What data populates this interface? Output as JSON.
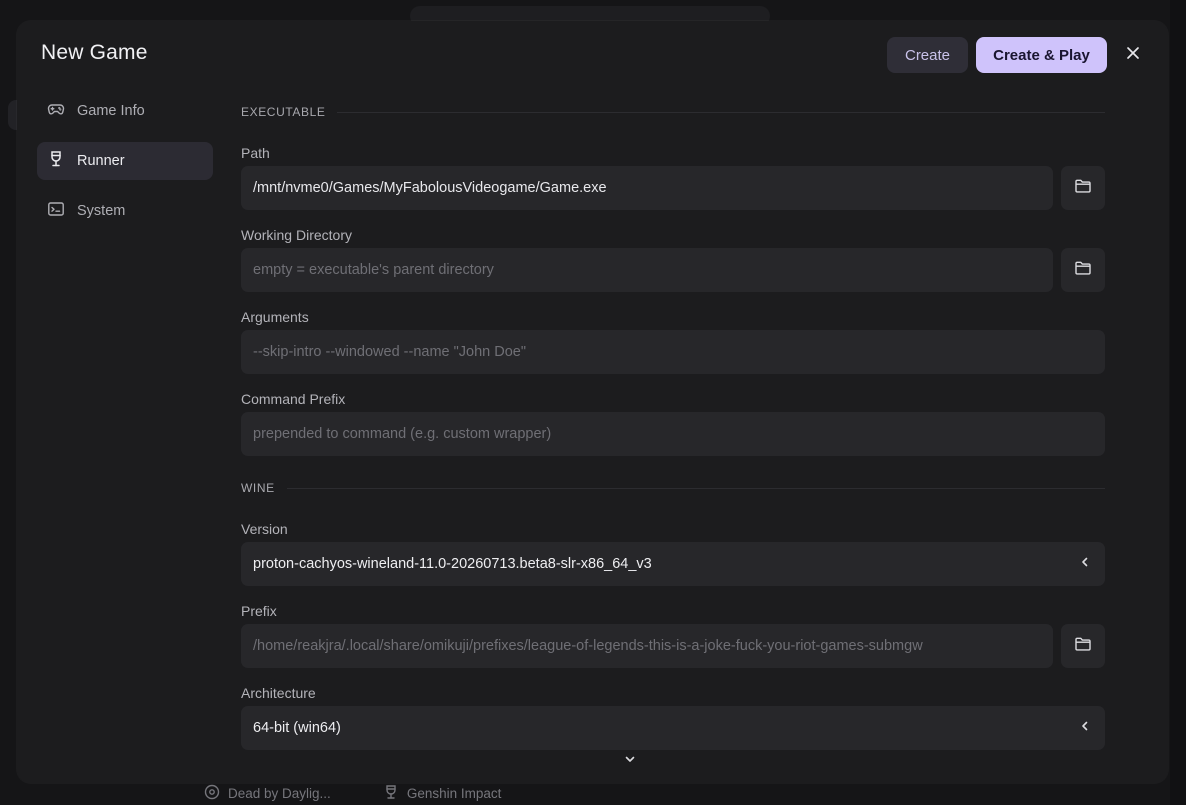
{
  "background": {
    "footer_items": [
      {
        "label": "Dead by Daylig...",
        "icon": "disc-icon"
      },
      {
        "label": "Genshin Impact",
        "icon": "goblet-icon"
      }
    ]
  },
  "dialog": {
    "title": "New Game",
    "create_label": "Create",
    "create_play_label": "Create & Play",
    "close_icon": "close-icon"
  },
  "sidebar": {
    "items": [
      {
        "label": "Game Info",
        "icon": "gamepad-icon",
        "active": false
      },
      {
        "label": "Runner",
        "icon": "goblet-icon",
        "active": true
      },
      {
        "label": "System",
        "icon": "terminal-icon",
        "active": false
      }
    ]
  },
  "executable": {
    "section_title": "EXECUTABLE",
    "path": {
      "label": "Path",
      "value": "/mnt/nvme0/Games/MyFabolousVideogame/Game.exe"
    },
    "working_directory": {
      "label": "Working Directory",
      "placeholder": "empty = executable's parent directory"
    },
    "arguments": {
      "label": "Arguments",
      "placeholder": "--skip-intro --windowed --name \"John Doe\""
    },
    "command_prefix": {
      "label": "Command Prefix",
      "placeholder": "prepended to command (e.g. custom wrapper)"
    }
  },
  "wine": {
    "section_title": "WINE",
    "version": {
      "label": "Version",
      "value": "proton-cachyos-wineland-11.0-20260713.beta8-slr-x86_64_v3"
    },
    "prefix": {
      "label": "Prefix",
      "placeholder": "/home/reakjra/.local/share/omikuji/prefixes/league-of-legends-this-is-a-joke-fuck-you-riot-games-submgw"
    },
    "architecture": {
      "label": "Architecture",
      "value": "64-bit (win64)"
    }
  },
  "colors": {
    "accent": "#cfc3fb",
    "dialog_bg": "#1c1c1e",
    "input_bg": "#27272a",
    "active_item_bg": "#2c2b33"
  }
}
